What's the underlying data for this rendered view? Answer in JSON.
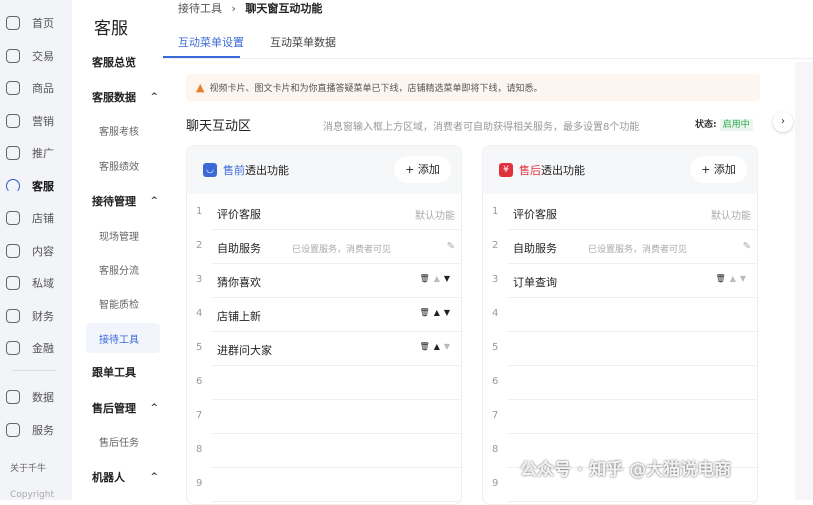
{
  "rail": {
    "items": [
      {
        "label": "首页",
        "icon": "home-icon"
      },
      {
        "label": "交易",
        "icon": "trade-icon"
      },
      {
        "label": "商品",
        "icon": "goods-icon"
      },
      {
        "label": "营销",
        "icon": "megaphone-icon"
      },
      {
        "label": "推广",
        "icon": "location-icon"
      },
      {
        "label": "客服",
        "icon": "headset-icon",
        "active": true
      },
      {
        "label": "店铺",
        "icon": "store-icon"
      },
      {
        "label": "内容",
        "icon": "content-icon"
      },
      {
        "label": "私域",
        "icon": "users-icon"
      },
      {
        "label": "财务",
        "icon": "yuan-icon"
      },
      {
        "label": "金融",
        "icon": "finance-icon"
      },
      {
        "label": "数据",
        "icon": "chart-icon"
      },
      {
        "label": "服务",
        "icon": "grid-icon"
      }
    ],
    "about": "关于千牛",
    "copyright": "Copyright"
  },
  "nav": {
    "title": "客服",
    "items": [
      {
        "label": "客服总览"
      },
      {
        "label": "客服数据",
        "caret": "^"
      },
      {
        "label": "客服考核",
        "sub": true
      },
      {
        "label": "客服绩效",
        "sub": true
      },
      {
        "label": "接待管理",
        "caret": "^"
      },
      {
        "label": "现场管理",
        "sub": true
      },
      {
        "label": "客服分流",
        "sub": true
      },
      {
        "label": "智能质检",
        "sub": true
      },
      {
        "label": "接待工具",
        "sub": true,
        "selected": true
      },
      {
        "label": "跟单工具"
      },
      {
        "label": "售后管理",
        "caret": "^"
      },
      {
        "label": "售后任务",
        "sub": true
      },
      {
        "label": "机器人",
        "caret": "^"
      }
    ]
  },
  "breadcrumb": {
    "parent": "接待工具",
    "sep": "›",
    "current": "聊天窗互动功能"
  },
  "tabs": [
    "互动菜单设置",
    "互动菜单数据"
  ],
  "notice": "视频卡片、图文卡片和为你直播答疑菜单已下线，店铺精选菜单即将下线，请知悉。",
  "section": {
    "title": "聊天互动区",
    "desc": "消息窗输入框上方区域，消费者可自助获得相关服务，最多设置8个功能",
    "status_label": "状态:",
    "status_value": "启用中",
    "status_color": "#2fa44f"
  },
  "cards": [
    {
      "highlight": "售前",
      "title": "透出功能",
      "color": "#3b6ad8",
      "badge": "◡",
      "add": "+ 添加",
      "rows": [
        {
          "n": "1",
          "t": "评价客服",
          "r": "默认功能"
        },
        {
          "n": "2",
          "t": "自助服务",
          "d": "已设置服务，消费者可见",
          "r": "✎"
        },
        {
          "n": "3",
          "t": "猜你喜欢",
          "ctl": true
        },
        {
          "n": "4",
          "t": "店铺上新",
          "ctl": true
        },
        {
          "n": "5",
          "t": "进群问大家",
          "ctl": true
        },
        {
          "n": "6"
        },
        {
          "n": "7"
        },
        {
          "n": "8"
        },
        {
          "n": "9"
        }
      ]
    },
    {
      "highlight": "售后",
      "title": "透出功能",
      "color": "#e0323c",
      "badge": "¥",
      "add": "+ 添加",
      "rows": [
        {
          "n": "1",
          "t": "评价客服",
          "r": "默认功能"
        },
        {
          "n": "2",
          "t": "自助服务",
          "d": "已设置服务，消费者可见",
          "r": "✎"
        },
        {
          "n": "3",
          "t": "订单查询",
          "ctl": true
        },
        {
          "n": "4"
        },
        {
          "n": "5"
        },
        {
          "n": "6"
        },
        {
          "n": "7"
        },
        {
          "n": "8"
        },
        {
          "n": "9"
        }
      ]
    }
  ],
  "watermark": "公众号 · 知乎 @大猫说电商"
}
